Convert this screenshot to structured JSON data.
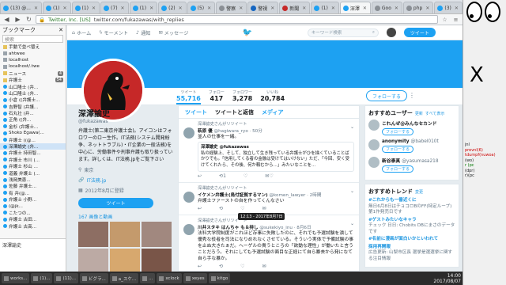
{
  "browser": {
    "tabs": [
      {
        "label": "(13) @...",
        "active": false,
        "color": "tw"
      },
      {
        "label": "(1)",
        "active": false,
        "color": "tw"
      },
      {
        "label": "(1)",
        "active": false,
        "color": "tw"
      },
      {
        "label": "(7)",
        "active": false,
        "color": "tw"
      },
      {
        "label": "(1)",
        "active": false,
        "color": "tw"
      },
      {
        "label": "(2)",
        "active": false,
        "color": "tw"
      },
      {
        "label": "(5)",
        "active": false,
        "color": "tw"
      },
      {
        "label": "警察",
        "active": false,
        "color": "gray"
      },
      {
        "label": "警視",
        "active": false,
        "color": "blue2"
      },
      {
        "label": "新聞",
        "active": false,
        "color": "red"
      },
      {
        "label": "(1)",
        "active": false,
        "color": "tw"
      },
      {
        "label": "深澤",
        "active": true,
        "color": "tw"
      },
      {
        "label": "Goo",
        "active": false,
        "color": "gray"
      },
      {
        "label": "php",
        "active": false,
        "color": "gray"
      },
      {
        "label": "(3)",
        "active": false,
        "color": "tw"
      },
      {
        "label": "弁護",
        "active": false,
        "color": "red"
      },
      {
        "label": "(5)",
        "active": false,
        "color": "tw"
      },
      {
        "label": "(5)",
        "active": false,
        "color": "tw"
      },
      {
        "label": "(2)",
        "active": false,
        "color": "tw"
      },
      {
        "label": "(5)",
        "active": false,
        "color": "tw"
      },
      {
        "label": "ongi",
        "active": false,
        "color": "gray"
      },
      {
        "label": "(12)",
        "active": false,
        "color": "tw"
      }
    ],
    "url_host": "Twitter, Inc. [US]",
    "url_path": "twitter.com/fukazawas/with_replies"
  },
  "sidebar": {
    "title": "ブックマーク",
    "search_placeholder": "検索",
    "items": [
      {
        "label": "手動で並べ替え",
        "icon": "folder",
        "count": ""
      },
      {
        "label": "ahtwee",
        "icon": "pg",
        "count": ""
      },
      {
        "label": "localhost",
        "icon": "pg",
        "count": ""
      },
      {
        "label": "localhost/.twe",
        "icon": "pg",
        "count": ""
      },
      {
        "label": "ニュース",
        "icon": "folder",
        "count": "4"
      },
      {
        "label": "弁護士",
        "icon": "folder",
        "count": "54"
      },
      {
        "label": "山口隆士 (弁...",
        "icon": "tw",
        "count": ""
      },
      {
        "label": "山口隆士 (弁...",
        "icon": "tw",
        "count": ""
      },
      {
        "label": "小倉 ((弁護士...",
        "icon": "tw",
        "count": ""
      },
      {
        "label": "吉野智 (弁護...",
        "icon": "tw",
        "count": ""
      },
      {
        "label": "石丸壮 (弁...",
        "icon": "tw",
        "count": ""
      },
      {
        "label": "正角 ((弁...",
        "icon": "tw",
        "count": ""
      },
      {
        "label": "金杉 (弁護士...",
        "icon": "tw",
        "count": ""
      },
      {
        "label": "Shoko Egawa(...",
        "icon": "tw",
        "count": ""
      },
      {
        "label": "弁護士 ((@...",
        "icon": "tw",
        "count": ""
      },
      {
        "label": "深澤諭史 (弁...",
        "icon": "tw",
        "count": ""
      },
      {
        "label": "弁護士 持田智...",
        "icon": "tw",
        "count": ""
      },
      {
        "label": "弁護士 市川 (...",
        "icon": "tw",
        "count": ""
      },
      {
        "label": "弁護士 杉山 ...",
        "icon": "tw",
        "count": ""
      },
      {
        "label": "道義 弁護士 (...",
        "icon": "tw",
        "count": ""
      },
      {
        "label": "浅岡美恵...",
        "icon": "tw",
        "count": ""
      },
      {
        "label": "佐藤 弁護士...",
        "icon": "tw",
        "count": ""
      },
      {
        "label": "有 弁(@...",
        "icon": "tw",
        "count": ""
      },
      {
        "label": "弁護士 小野...",
        "icon": "tw",
        "count": ""
      },
      {
        "label": "(@jk...",
        "icon": "tw",
        "count": ""
      },
      {
        "label": "こたつの...",
        "icon": "tw",
        "count": ""
      },
      {
        "label": "弁護士 古田...",
        "icon": "tw",
        "count": ""
      },
      {
        "label": "弁護士 古高...",
        "icon": "tw",
        "count": ""
      }
    ],
    "mini_label": "深澤諭史"
  },
  "twitter": {
    "nav": {
      "home": "ホーム",
      "moments": "モーメント",
      "notifications": "通知",
      "messages": "メッセージ"
    },
    "search_placeholder": "キーワード検索",
    "tweet_button": "ツイート",
    "stats": [
      {
        "label": "ツイート",
        "value": "55,716",
        "active": true
      },
      {
        "label": "フォロー",
        "value": "417",
        "active": false
      },
      {
        "label": "フォロワー",
        "value": "3,278",
        "active": false
      },
      {
        "label": "いいね",
        "value": "20,784",
        "active": false
      }
    ],
    "follow_button": "フォローする",
    "profile": {
      "name": "深澤諭史",
      "handle": "@fukazawas",
      "bio": "弁護士(第二東京弁護士会)。アイコンはフォロワーのロー生作。IT法務(システム開発紛争、ネットトラブル)・IT企業の一般法務)を中心に、労働事件や刑事弁護も取り扱っています。詳しくは、IT法務.jpをご覧下さい",
      "location": "東京",
      "link": "IT法務.jp",
      "joined": "2012年8月に登録",
      "tweet_button": "ツイート",
      "photos": "167 画像と動画"
    },
    "timeline_tabs": [
      "ツイート",
      "ツイートと返信",
      "メディア"
    ],
    "tweets": [
      {
        "context": "深澤諭史さんがリツイート",
        "name": "萩原 優",
        "handle": "@hagiwara_ryo",
        "time": "50分",
        "text": "並人の仕事を一緒。",
        "quote_name": "深澤諭史 @fukazawas",
        "quote_text": "私の経験上、そして、独立して生き残っている弁護士がひを描くていることばかりでも。「信用してくる者の金融は受けてはいけない」ただ、「今回、安く受けてくれたら、その後、何か頼むから…」みたいなことを...",
        "actions": [
          "",
          "1",
          "",
          "♡"
        ]
      },
      {
        "context": "深澤諭史さんがリツイート",
        "name": "イケメン弁護士(鳥付証拠するマン)",
        "handle": "@komen_lawyer",
        "time": "2時間",
        "text": "弁護士ファーストの自を作ってくんなさい",
        "quote_name": "",
        "quote_text": "",
        "actions": [
          "",
          "",
          "",
          ""
        ]
      },
      {
        "context": "深澤諭史さんがリツイート",
        "name": "川井スタキ はんちゃ も＆持し",
        "handle": "@sukekiyo_inu",
        "time": "8月6日",
        "text": "法科大学院制度がこれほど存事に失敗したのに、それでも予選試験を潰して優秀な役者を司法になりめれなくさせている。そういう実体で予備試験の事を止ぬ大きたぁだ。ヘーゲルの貴うところの「欲動な理性」が働いたと言うことだろう。それにしても予選試験の面目な正経にて自ら暴去から発になて自ら手な暴か。",
        "quote_name": "",
        "quote_text": "",
        "actions": [
          "",
          "",
          "",
          ""
        ]
      }
    ],
    "tooltip": "12:13 - 2017年8月7日",
    "who_to_follow": {
      "title": "おすすめユーザー",
      "refresh": "更新",
      "all": "すべて表示",
      "users": [
        {
          "name": "これんぜ@みんなセカンド",
          "handle": "",
          "button": "フォローする"
        },
        {
          "name": "anonymity",
          "handle": "@babel010t",
          "button": "フォローする"
        },
        {
          "name": "新谷泰真",
          "handle": "@yasumasa218",
          "button": "フォローする"
        }
      ]
    },
    "trends": {
      "title": "おすすめトレンド",
      "change": "変更",
      "items": [
        {
          "tag": "#これからも一番近くに",
          "desc": "無日6月8日はチョコロBのFF(特定ループ)第1作発売日です"
        },
        {
          "tag": "#ゲストみたいなキャラ",
          "desc": "チェック 日日: Chobits DBにまさのデータです"
        },
        {
          "tag": "#名前に漫画が面白いかといわれて",
          "desc": ""
        },
        {
          "tag": "採用再開報",
          "desc": "広告更新: 山梨市区長 選挙是選選挙に関する注目情報"
        }
      ]
    }
  },
  "taskbar": {
    "items": [
      "works...",
      "(1)...",
      "(11)...",
      "ビグラ...",
      "a_スケ...",
      "...",
      "xclock",
      "xeyes",
      "kitgo"
    ],
    "clock_time": "14:00",
    "clock_date": "2017/08/07"
  },
  "desktop": {
    "big_label": "X",
    "list": [
      {
        "text": "jnl",
        "cls": ""
      },
      {
        "text": "prevnl(6)",
        "cls": "r"
      },
      {
        "text": "tdumpf(nuwoa)",
        "cls": "r"
      },
      {
        "text": "(wo)",
        "cls": ""
      },
      {
        "text": "",
        "cls": ""
      },
      {
        "text": "r (pc",
        "cls": "g"
      },
      {
        "text": "",
        "cls": ""
      },
      {
        "text": "(dpr)",
        "cls": ""
      },
      {
        "text": "",
        "cls": ""
      },
      {
        "text": "",
        "cls": ""
      },
      {
        "text": "r)(pc",
        "cls": ""
      }
    ]
  }
}
